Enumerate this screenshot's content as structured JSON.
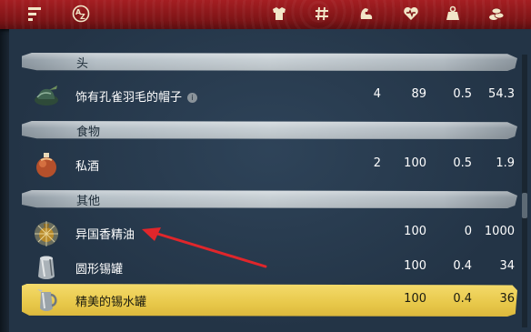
{
  "header": {
    "icons": [
      "sort-icon",
      "alphabetical-sort-icon",
      "armor-icon",
      "quantity-icon",
      "strength-icon",
      "health-icon",
      "weight-icon",
      "value-icon"
    ]
  },
  "sections": [
    {
      "label": "头"
    },
    {
      "label": "食物"
    },
    {
      "label": "其他"
    }
  ],
  "items": [
    {
      "name": "饰有孔雀羽毛的帽子",
      "col1": "4",
      "col2": "89",
      "col3": "0.5",
      "col4": "54.3",
      "icon": "feathered-hat-icon",
      "info": "i"
    },
    {
      "name": "私酒",
      "col1": "2",
      "col2": "100",
      "col3": "0.5",
      "col4": "1.9",
      "icon": "liquor-flask-icon"
    },
    {
      "name": "异国香精油",
      "col1": "",
      "col2": "100",
      "col3": "0",
      "col4": "1000",
      "icon": "exotic-oil-icon"
    },
    {
      "name": "圆形锡罐",
      "col1": "",
      "col2": "100",
      "col3": "0.4",
      "col4": "34",
      "icon": "tin-can-icon"
    },
    {
      "name": "精美的锡水罐",
      "col1": "",
      "col2": "100",
      "col3": "0.4",
      "col4": "36",
      "icon": "tin-jug-icon",
      "selected": true
    }
  ],
  "colors": {
    "header": "#a51e22",
    "background": "#243548",
    "selected": "#e8c84a",
    "arrow": "#e0262b"
  }
}
